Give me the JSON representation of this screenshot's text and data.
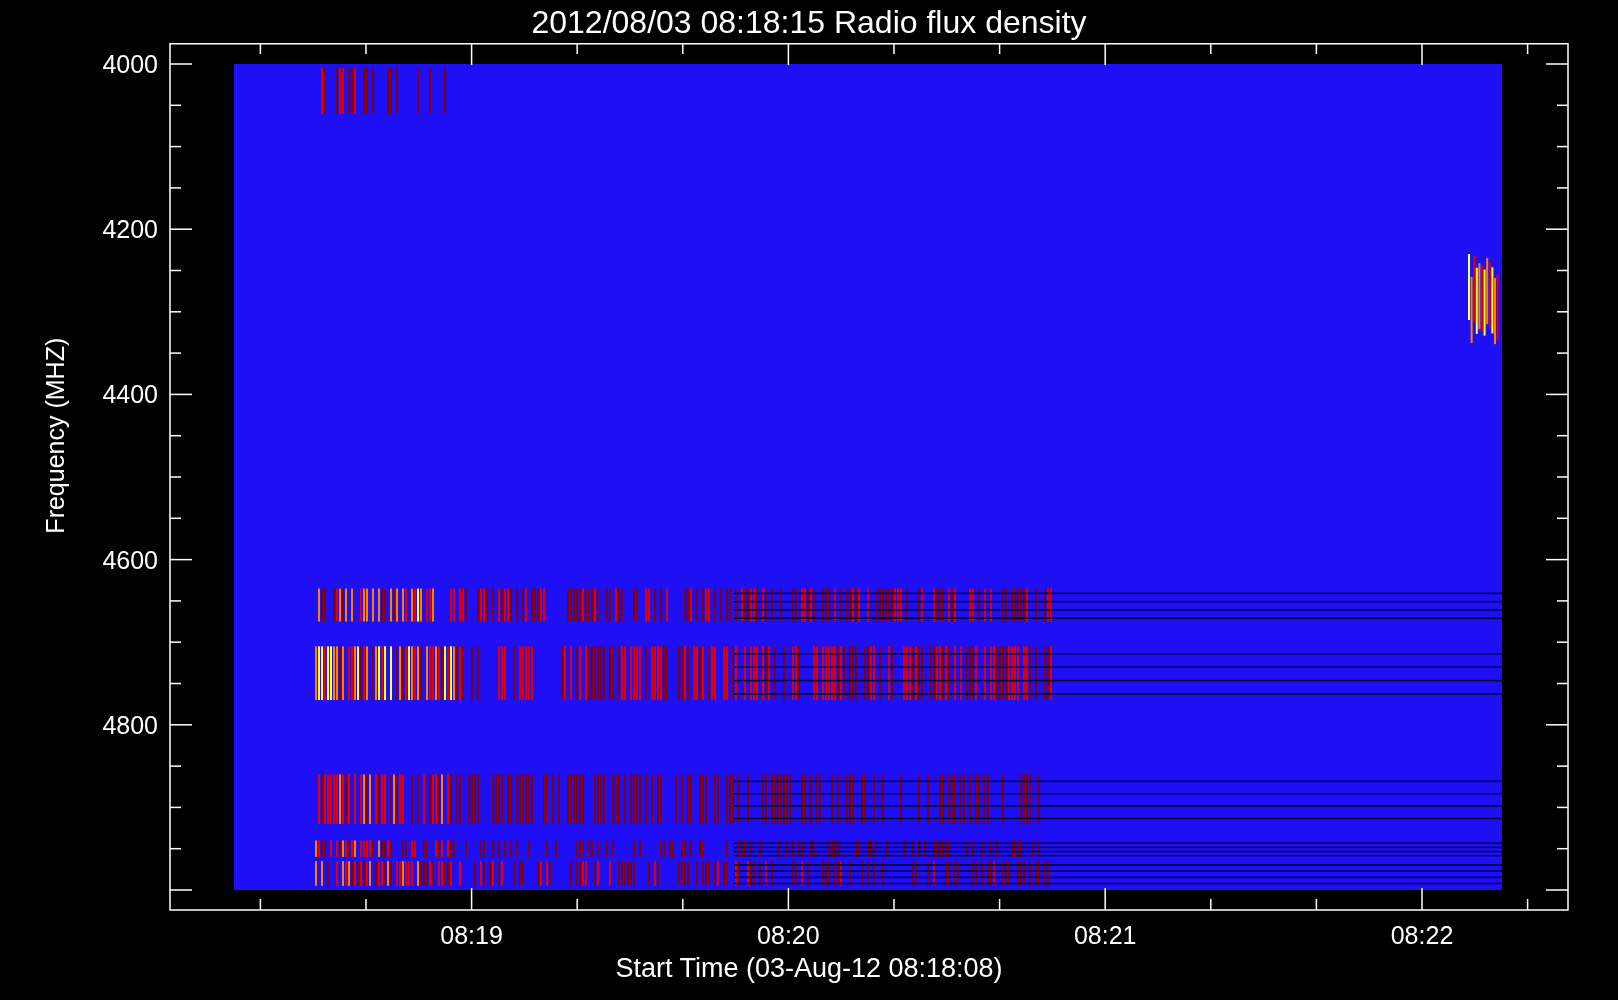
{
  "title": "2012/08/03 08:18:15 Radio flux density",
  "y_axis": {
    "title": "Frequency (MHZ)",
    "tick_labels": [
      "4000",
      "4200",
      "4400",
      "4600",
      "4800"
    ]
  },
  "x_axis": {
    "title": "Start Time (03-Aug-12 08:18:08)",
    "tick_labels": [
      "08:19",
      "08:20",
      "08:21",
      "08:22"
    ]
  }
}
